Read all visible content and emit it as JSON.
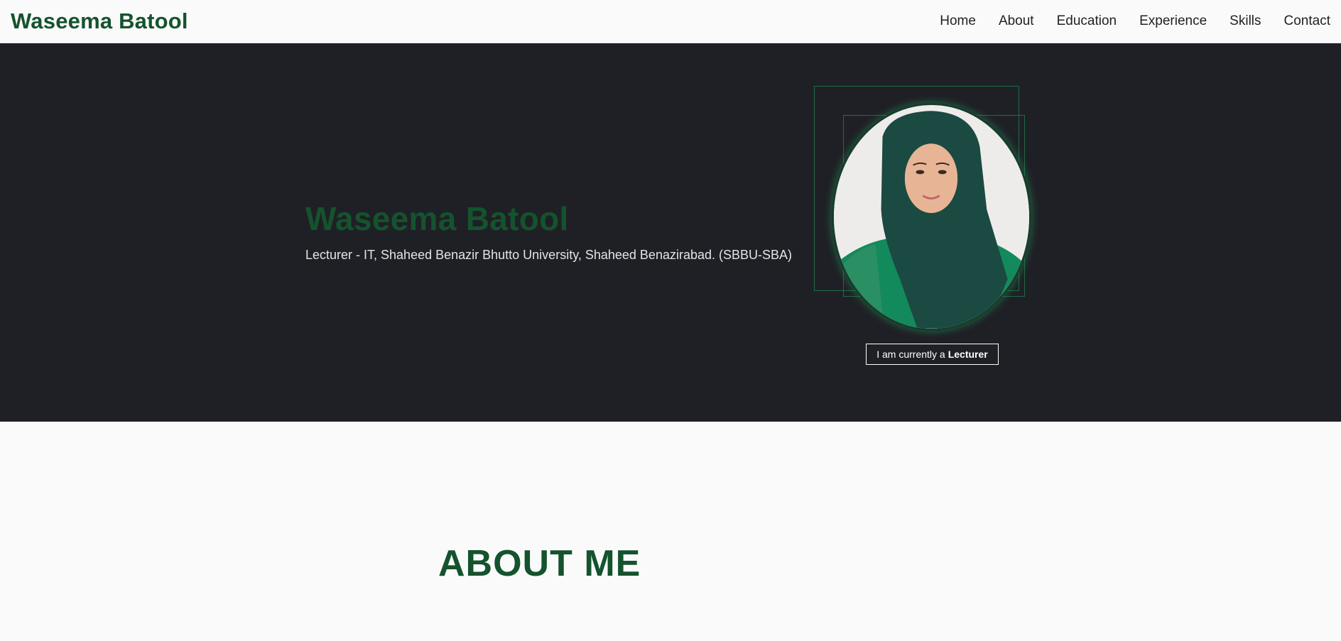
{
  "navbar": {
    "brand": "Waseema Batool",
    "links": [
      "Home",
      "About",
      "Education",
      "Experience",
      "Skills",
      "Contact"
    ]
  },
  "hero": {
    "name": "Waseema Batool",
    "subtitle": "Lecturer - IT, Shaheed Benazir Bhutto University, Shaheed Benazirabad. (SBBU-SBA)",
    "status_prefix": "I am currently a",
    "status_role": "Lecturer"
  },
  "about": {
    "title": "ABOUT ME"
  },
  "colors": {
    "accent": "#14532d",
    "hero_background": "#1f2026",
    "page_background": "#fafafa"
  }
}
